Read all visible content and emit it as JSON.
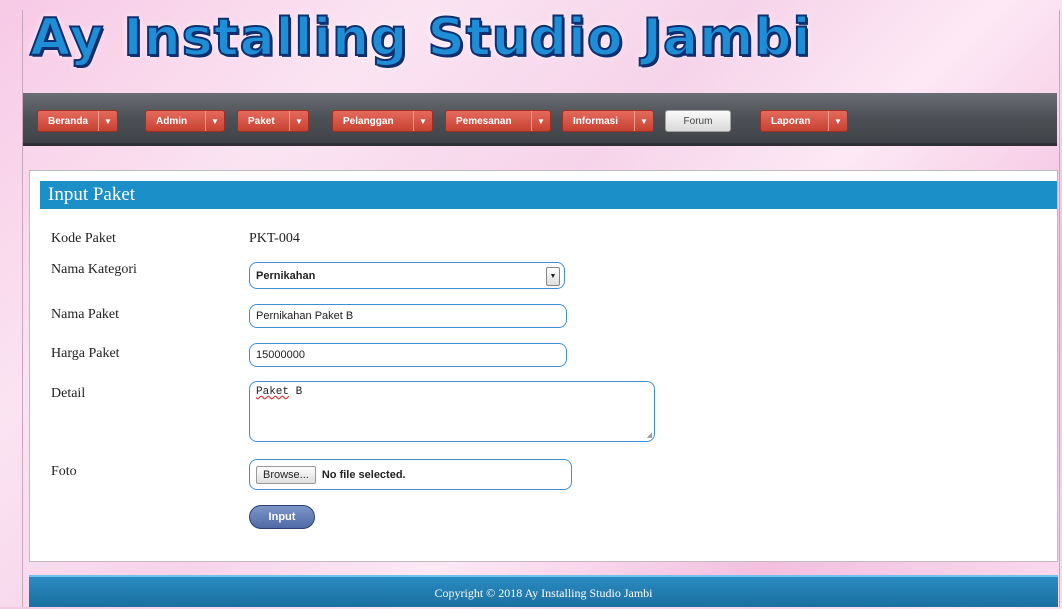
{
  "site": {
    "title": "Ay Installing Studio Jambi"
  },
  "nav": {
    "items": [
      {
        "label": "Beranda"
      },
      {
        "label": "Admin"
      },
      {
        "label": "Paket"
      },
      {
        "label": "Pelanggan"
      },
      {
        "label": "Pemesanan"
      },
      {
        "label": "Informasi"
      },
      {
        "label": "Forum"
      },
      {
        "label": "Laporan"
      }
    ],
    "caret": "▼"
  },
  "form": {
    "title": "Input Paket",
    "kode_label": "Kode Paket",
    "kode_value": "PKT-004",
    "kategori_label": "Nama Kategori",
    "kategori_value": "Pernikahan",
    "nama_label": "Nama Paket",
    "nama_value": "Pernikahan Paket B",
    "harga_label": "Harga Paket",
    "harga_value": "15000000",
    "detail_label": "Detail",
    "detail_word1": "Paket",
    "detail_word2": " B",
    "foto_label": "Foto",
    "browse_label": "Browse...",
    "file_status": "No file selected.",
    "submit_label": "Input"
  },
  "footer": {
    "text": "Copyright © 2018 Ay Installing Studio Jambi"
  },
  "colors": {
    "accent": "#1b8fc7",
    "nav_button": "#d65244",
    "field_border": "#3f8fd0",
    "submit_button": "#5f78b3"
  }
}
